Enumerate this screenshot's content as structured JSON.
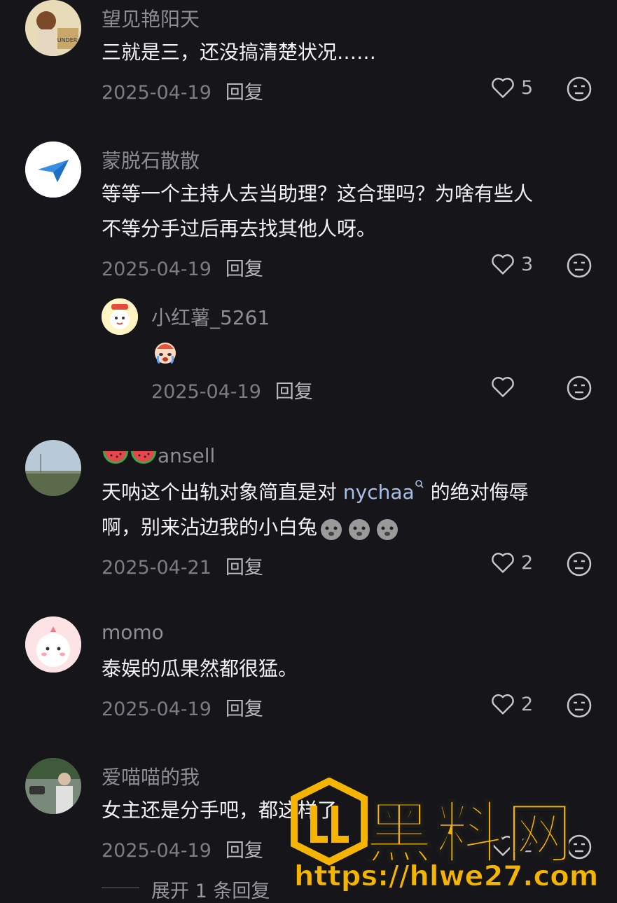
{
  "comments": [
    {
      "user": "望见艳阳天",
      "lines": [
        "三就是三，还没搞清楚状况……"
      ],
      "date": "2025-04-19",
      "reply": "回复",
      "likes": "5"
    },
    {
      "user": "蒙脱石散散",
      "lines": [
        "等等一个主持人去当助理？这合理吗？为啥有些人",
        "不等分手过后再去找其他人呀。"
      ],
      "date": "2025-04-19",
      "reply": "回复",
      "likes": "3"
    },
    {
      "user": "小红薯_5261",
      "lines": [
        ""
      ],
      "date": "2025-04-19",
      "reply": "回复",
      "likes": ""
    },
    {
      "user": "ansell",
      "line1_pre": "天呐这个出轨对象简直是对 ",
      "line1_link": "nychaa",
      "line1_post": " 的绝对侮辱",
      "line2": "啊，别来沾边我的小白兔",
      "date": "2025-04-21",
      "reply": "回复",
      "likes": "2"
    },
    {
      "user": "momo",
      "lines": [
        "泰娱的瓜果然都很猛。"
      ],
      "date": "2025-04-19",
      "reply": "回复",
      "likes": "2"
    },
    {
      "user": "爱喵喵的我",
      "lines": [
        "女主还是分手吧，都这样了"
      ],
      "date": "2025-04-19",
      "reply": "回复",
      "likes": "2"
    }
  ],
  "expand_label": "展开 1 条回复",
  "watermark": {
    "brand": "黑料网",
    "url": "https://hlwe27.com"
  },
  "colors": {
    "background": "#16161a",
    "text": "#f2f2f2",
    "muted": "#8d8d93",
    "link": "#a9bfe6",
    "watermark": "#f5b400"
  }
}
